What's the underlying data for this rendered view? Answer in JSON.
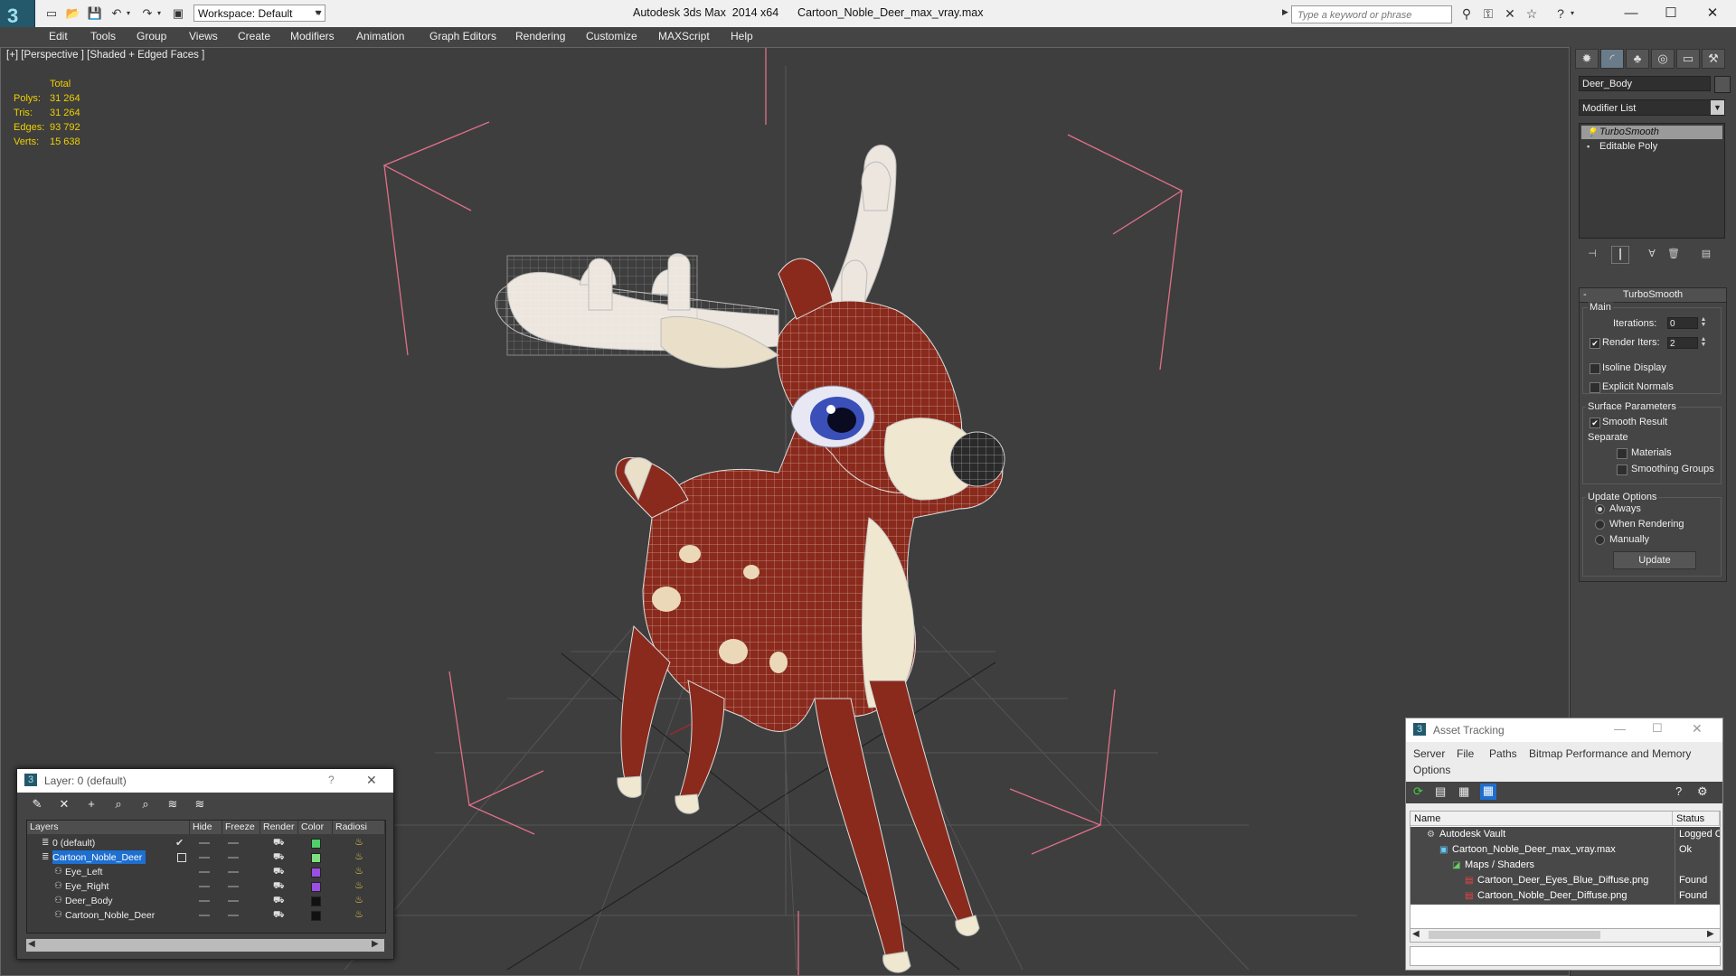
{
  "app": {
    "window_title": "Autodesk 3ds Max  2014 x64      Cartoon_Noble_Deer_max_vray.max",
    "workspace": "Workspace: Default",
    "search_placeholder": "Type a keyword or phrase",
    "logo": "3"
  },
  "quick_access": [
    "new-file",
    "open-file",
    "save-file",
    "undo",
    "redo",
    "project-folder"
  ],
  "menu": [
    "Edit",
    "Tools",
    "Group",
    "Views",
    "Create",
    "Modifiers",
    "Animation",
    "Graph Editors",
    "Rendering",
    "Customize",
    "MAXScript",
    "Help"
  ],
  "viewport": {
    "label": "[+] [Perspective ] [Shaded + Edged Faces ]",
    "stats_header": "Total",
    "stats": [
      {
        "label": "Polys:",
        "value": "31 264"
      },
      {
        "label": "Tris:",
        "value": "31 264"
      },
      {
        "label": "Edges:",
        "value": "93 792"
      },
      {
        "label": "Verts:",
        "value": "15 638"
      }
    ]
  },
  "command_panel": {
    "object_name": "Deer_Body",
    "modifier_list": "Modifier List",
    "stack": [
      "TurboSmooth",
      "Editable Poly"
    ],
    "turbosmooth": {
      "title": "TurboSmooth",
      "main_label": "Main",
      "iterations_label": "Iterations:",
      "iterations_value": "0",
      "render_iters_label": "Render Iters:",
      "render_iters_value": "2",
      "render_iters_checked": true,
      "isoline_label": "Isoline Display",
      "explicit_normals_label": "Explicit Normals",
      "surface_params_label": "Surface Parameters",
      "smooth_result_label": "Smooth Result",
      "separate_label": "Separate",
      "materials_label": "Materials",
      "smoothing_groups_label": "Smoothing Groups",
      "update_options_label": "Update Options",
      "always_label": "Always",
      "when_rendering_label": "When Rendering",
      "manually_label": "Manually",
      "update_button": "Update"
    }
  },
  "layer_dialog": {
    "title": "Layer: 0 (default)",
    "help": "?",
    "close": "✕",
    "columns": [
      "Layers",
      "Hide",
      "Freeze",
      "Render",
      "Color",
      "Radiosi"
    ],
    "rows": [
      {
        "name": "0 (default)",
        "indent": 1,
        "color": "#4fd06a",
        "current": true,
        "selected": false
      },
      {
        "name": "Cartoon_Noble_Deer",
        "indent": 1,
        "color": "#7fe07f",
        "current": false,
        "selected": true
      },
      {
        "name": "Eye_Left",
        "indent": 2,
        "color": "#9a4fe0",
        "current": false,
        "selected": false
      },
      {
        "name": "Eye_Right",
        "indent": 2,
        "color": "#9a4fe0",
        "current": false,
        "selected": false
      },
      {
        "name": "Deer_Body",
        "indent": 2,
        "color": "#111111",
        "current": false,
        "selected": false
      },
      {
        "name": "Cartoon_Noble_Deer",
        "indent": 2,
        "color": "#111111",
        "current": false,
        "selected": false
      }
    ]
  },
  "asset_tracking": {
    "title": "Asset Tracking",
    "menu": [
      "Server",
      "File",
      "Paths",
      "Bitmap Performance and Memory",
      "Options"
    ],
    "columns": [
      "Name",
      "Status"
    ],
    "rows": [
      {
        "name": "Autodesk Vault",
        "status": "Logged C",
        "indent": 1
      },
      {
        "name": "Cartoon_Noble_Deer_max_vray.max",
        "status": "Ok",
        "indent": 2
      },
      {
        "name": "Maps / Shaders",
        "status": "",
        "indent": 3
      },
      {
        "name": "Cartoon_Deer_Eyes_Blue_Diffuse.png",
        "status": "Found",
        "indent": 4
      },
      {
        "name": "Cartoon_Noble_Deer_Diffuse.png",
        "status": "Found",
        "indent": 4
      }
    ]
  }
}
